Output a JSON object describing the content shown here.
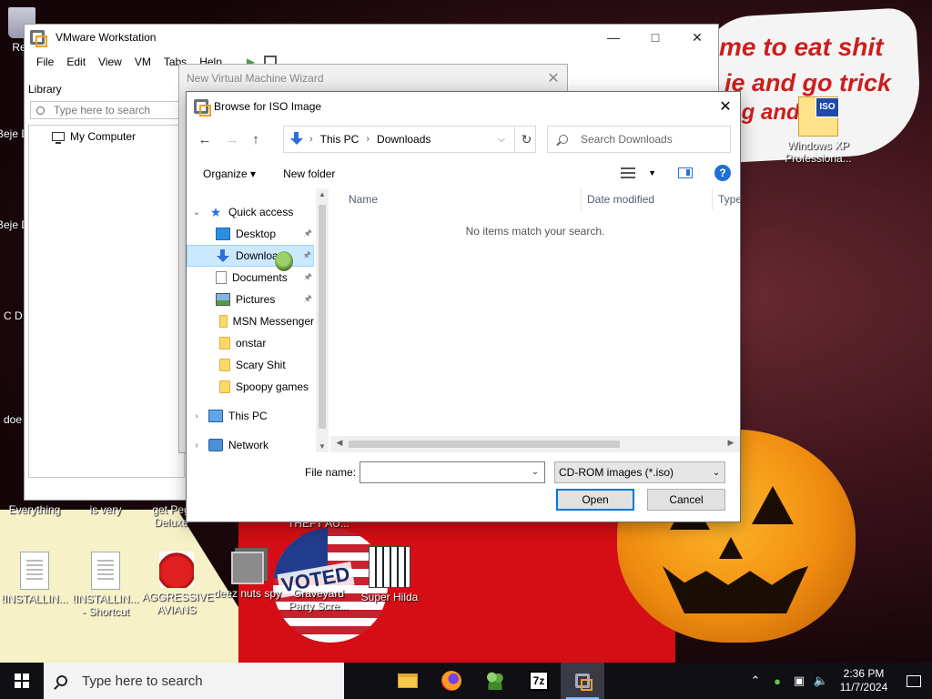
{
  "wallpaper": {
    "caption_line1": "me to eat shit",
    "caption_line2": "ie and go trick",
    "caption_line3": "ng and       e!",
    "badge": "VOTED"
  },
  "desktop": {
    "icons": [
      {
        "label": "Rec",
        "icon": "recycle-bin-icon"
      },
      {
        "label": "Beje D",
        "icon": "game-shortcut-icon"
      },
      {
        "label": "Beje D",
        "icon": "game-shortcut-icon"
      },
      {
        "label": "C D",
        "icon": "app-shortcut-icon"
      },
      {
        "label": "doe",
        "icon": "app-shortcut-icon"
      },
      {
        "label": "Windows XP Professiona...",
        "icon": "iso-file-icon"
      },
      {
        "label": "Everything",
        "icon": "search-app-icon"
      },
      {
        "label": "is very",
        "icon": "file-icon"
      },
      {
        "label": "get Peg Deluxe",
        "icon": "game-shortcut-icon"
      },
      {
        "label": "THEFT AU...",
        "icon": "game-shortcut-icon"
      },
      {
        "label": "!INSTALLIN...",
        "icon": "text-document-icon"
      },
      {
        "label": "!INSTALLIN... - Shortcut",
        "icon": "text-document-shortcut-icon"
      },
      {
        "label": "AGGRESSIVE AVIANS",
        "icon": "angry-bird-icon"
      },
      {
        "label": "deez nuts spy",
        "icon": "app-shortcut-icon"
      },
      {
        "label": "Graveyard Party Scre...",
        "icon": "game-shortcut-icon"
      },
      {
        "label": "Super Hilda",
        "icon": "pixel-game-icon"
      }
    ],
    "iso_badge": "ISO"
  },
  "vmware": {
    "title": "VMware Workstation",
    "menus": [
      "File",
      "Edit",
      "View",
      "VM",
      "Tabs",
      "Help"
    ],
    "library_label": "Library",
    "search_placeholder": "Type here to search",
    "tree_root": "My Computer"
  },
  "wizard": {
    "title": "New Virtual Machine Wizard"
  },
  "dialog": {
    "title": "Browse for ISO Image",
    "address": {
      "root": "This PC",
      "current": "Downloads"
    },
    "search_placeholder": "Search Downloads",
    "organize_label": "Organize ▾",
    "new_folder_label": "New folder",
    "help_label": "?",
    "nav_items": [
      {
        "label": "Quick access",
        "icon": "star-icon",
        "kind": "group"
      },
      {
        "label": "Desktop",
        "icon": "desktop-folder-icon",
        "pinned": true
      },
      {
        "label": "Downloads",
        "icon": "downloads-folder-icon",
        "pinned": true,
        "selected": true
      },
      {
        "label": "Documents",
        "icon": "documents-folder-icon",
        "pinned": true
      },
      {
        "label": "Pictures",
        "icon": "pictures-folder-icon",
        "pinned": true
      },
      {
        "label": "MSN Messenger",
        "icon": "folder-icon"
      },
      {
        "label": "onstar",
        "icon": "folder-icon"
      },
      {
        "label": "Scary Shit",
        "icon": "folder-icon"
      },
      {
        "label": "Spoopy games",
        "icon": "folder-icon"
      },
      {
        "label": "This PC",
        "icon": "this-pc-icon",
        "kind": "group"
      },
      {
        "label": "Network",
        "icon": "network-icon",
        "kind": "group"
      }
    ],
    "columns": [
      "Name",
      "Date modified",
      "Type"
    ],
    "empty_message": "No items match your search.",
    "file_name_label": "File name:",
    "file_name_value": "",
    "file_type": "CD-ROM images (*.iso)",
    "open_label": "Open",
    "cancel_label": "Cancel"
  },
  "taskbar": {
    "search_placeholder": "Type here to search",
    "apps": [
      "file-explorer-icon",
      "firefox-icon",
      "msn-messenger-icon",
      "7zip-icon",
      "vmware-icon"
    ],
    "app_7zip_label": "7z",
    "time": "2:36 PM",
    "date": "11/7/2024"
  }
}
